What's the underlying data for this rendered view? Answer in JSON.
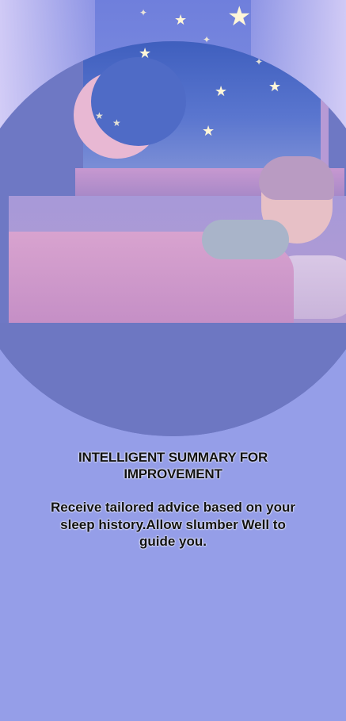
{
  "onboarding": {
    "title": "INTELLIGENT SUMMARY FOR IMPROVEMENT",
    "description": "Receive tailored advice based on your sleep history.Allow slumber Well to guide you."
  },
  "illustration": {
    "subject": "sleeping-child-under-moon"
  },
  "colors": {
    "background": "#959ee8",
    "circle": "#6e78c4",
    "text": "#111111"
  }
}
